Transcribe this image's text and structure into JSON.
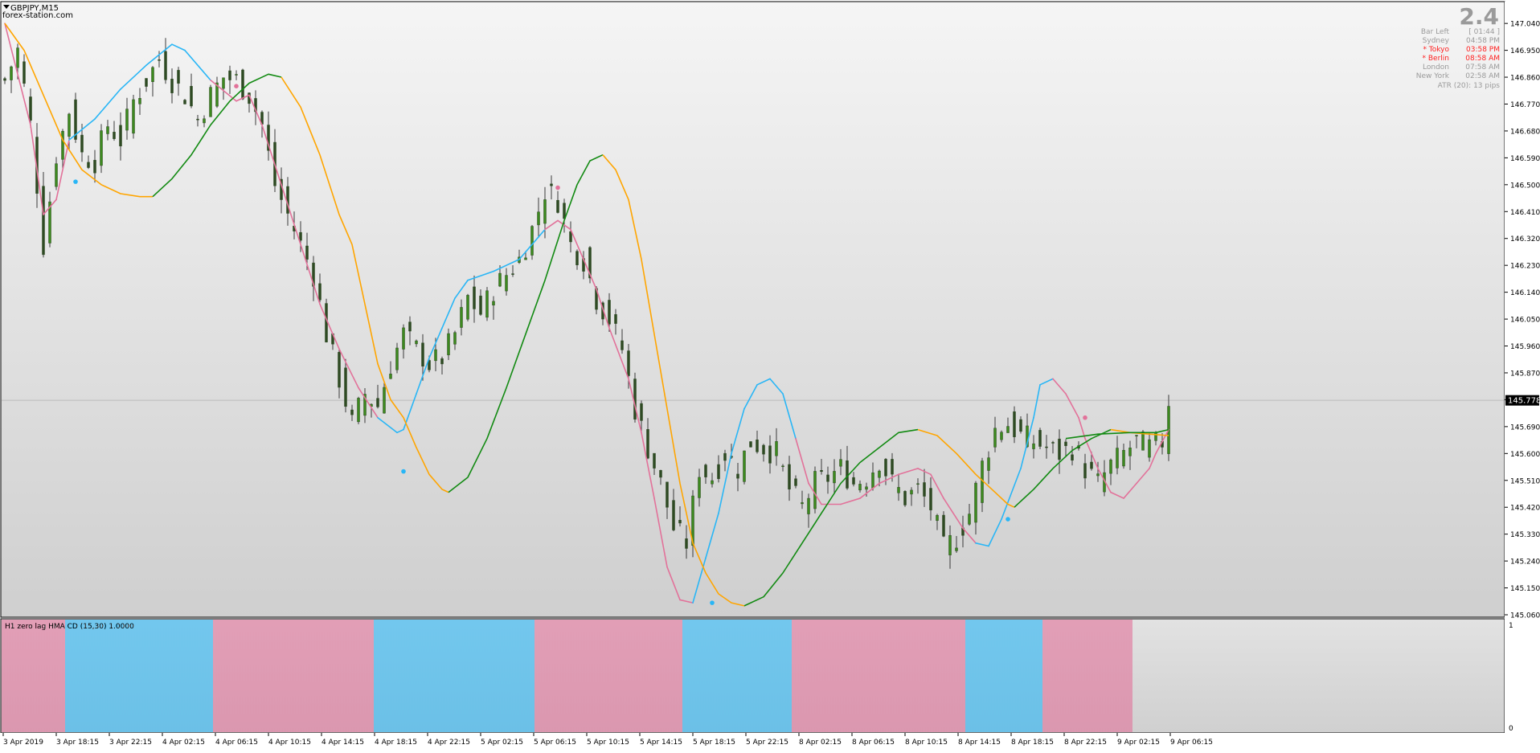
{
  "window": {
    "title": "GBPJPY,M15",
    "watermark": "forex-station.com"
  },
  "info_panel": {
    "big_value": "2.4",
    "rows": [
      {
        "label": "Bar Left",
        "value": "[ 01:44 ]",
        "color": "#9a9a9a"
      },
      {
        "label": "Sydney",
        "value": "04:58 PM",
        "color": "#9a9a9a"
      },
      {
        "label": "* Tokyo",
        "value": "03:58 PM",
        "color": "#ff2020"
      },
      {
        "label": "* Berlin",
        "value": "08:58 AM",
        "color": "#ff2020"
      },
      {
        "label": "London",
        "value": "07:58 AM",
        "color": "#9a9a9a"
      },
      {
        "label": "New York",
        "value": "02:58 AM",
        "color": "#9a9a9a"
      }
    ],
    "atr": "ATR (20): 13 pips"
  },
  "current_price": "145.778",
  "subwindow": {
    "label": "H1 zero lag HMA CD (15,30) 1.0000",
    "axis_top": "1",
    "axis_bottom": "0",
    "segments": [
      {
        "start": 0,
        "end": 10,
        "state": "down"
      },
      {
        "start": 10,
        "end": 33,
        "state": "up"
      },
      {
        "start": 33,
        "end": 58,
        "state": "down"
      },
      {
        "start": 58,
        "end": 83,
        "state": "up"
      },
      {
        "start": 83,
        "end": 106,
        "state": "down"
      },
      {
        "start": 106,
        "end": 123,
        "state": "up"
      },
      {
        "start": 123,
        "end": 150,
        "state": "down"
      },
      {
        "start": 150,
        "end": 162,
        "state": "up"
      },
      {
        "start": 162,
        "end": 176,
        "state": "down"
      }
    ]
  },
  "colors": {
    "bull_candle": "#3c8a1e",
    "bear_candle": "#3a3a3a",
    "hma_up": "#29b6f6",
    "hma_down": "#e2729a",
    "slow_orange": "#ffa500",
    "slow_green": "#128a12",
    "bg_top": "#f4f4f4",
    "bg_bottom": "#cfcfcf"
  },
  "chart_data": {
    "type": "candlestick",
    "symbol": "GBPJPY",
    "timeframe": "M15",
    "ylim": [
      145.06,
      147.07
    ],
    "y_ticks": [
      "147.040",
      "146.950",
      "146.860",
      "146.770",
      "146.680",
      "146.590",
      "146.500",
      "146.410",
      "146.320",
      "146.230",
      "146.140",
      "146.050",
      "145.960",
      "145.870",
      "145.780",
      "145.690",
      "145.600",
      "145.510",
      "145.420",
      "145.330",
      "145.240",
      "145.150",
      "145.060"
    ],
    "x_labels": [
      "3 Apr 2019",
      "3 Apr 18:15",
      "3 Apr 22:15",
      "4 Apr 02:15",
      "4 Apr 06:15",
      "4 Apr 10:15",
      "4 Apr 14:15",
      "4 Apr 18:15",
      "4 Apr 22:15",
      "5 Apr 02:15",
      "5 Apr 06:15",
      "5 Apr 10:15",
      "5 Apr 14:15",
      "5 Apr 18:15",
      "5 Apr 22:15",
      "8 Apr 02:15",
      "8 Apr 06:15",
      "8 Apr 10:15",
      "8 Apr 14:15",
      "8 Apr 18:15",
      "8 Apr 22:15",
      "9 Apr 02:15",
      "9 Apr 06:15"
    ],
    "close_path": [
      [
        0,
        146.85
      ],
      [
        2,
        146.95
      ],
      [
        4,
        146.7
      ],
      [
        6,
        146.3
      ],
      [
        8,
        146.6
      ],
      [
        10,
        146.75
      ],
      [
        12,
        146.6
      ],
      [
        14,
        146.58
      ],
      [
        16,
        146.7
      ],
      [
        18,
        146.65
      ],
      [
        20,
        146.78
      ],
      [
        22,
        146.85
      ],
      [
        24,
        146.92
      ],
      [
        26,
        146.85
      ],
      [
        28,
        146.8
      ],
      [
        30,
        146.72
      ],
      [
        32,
        146.8
      ],
      [
        34,
        146.86
      ],
      [
        36,
        146.85
      ],
      [
        38,
        146.8
      ],
      [
        40,
        146.7
      ],
      [
        42,
        146.5
      ],
      [
        44,
        146.4
      ],
      [
        46,
        146.3
      ],
      [
        48,
        146.2
      ],
      [
        50,
        146.0
      ],
      [
        52,
        145.85
      ],
      [
        54,
        145.7
      ],
      [
        56,
        145.8
      ],
      [
        58,
        145.76
      ],
      [
        60,
        145.9
      ],
      [
        62,
        146.0
      ],
      [
        64,
        145.95
      ],
      [
        66,
        145.9
      ],
      [
        68,
        145.92
      ],
      [
        70,
        146.0
      ],
      [
        72,
        146.12
      ],
      [
        74,
        146.07
      ],
      [
        76,
        146.15
      ],
      [
        78,
        146.2
      ],
      [
        80,
        146.25
      ],
      [
        82,
        146.35
      ],
      [
        84,
        146.48
      ],
      [
        86,
        146.45
      ],
      [
        88,
        146.3
      ],
      [
        90,
        146.25
      ],
      [
        92,
        146.12
      ],
      [
        94,
        146.05
      ],
      [
        96,
        145.95
      ],
      [
        98,
        145.75
      ],
      [
        100,
        145.62
      ],
      [
        102,
        145.5
      ],
      [
        104,
        145.35
      ],
      [
        106,
        145.3
      ],
      [
        108,
        145.55
      ],
      [
        110,
        145.52
      ],
      [
        112,
        145.6
      ],
      [
        114,
        145.55
      ],
      [
        116,
        145.64
      ],
      [
        118,
        145.62
      ],
      [
        120,
        145.6
      ],
      [
        122,
        145.48
      ],
      [
        124,
        145.42
      ],
      [
        126,
        145.5
      ],
      [
        128,
        145.52
      ],
      [
        130,
        145.55
      ],
      [
        132,
        145.5
      ],
      [
        134,
        145.52
      ],
      [
        136,
        145.58
      ],
      [
        138,
        145.5
      ],
      [
        140,
        145.45
      ],
      [
        142,
        145.48
      ],
      [
        144,
        145.42
      ],
      [
        146,
        145.28
      ],
      [
        148,
        145.32
      ],
      [
        150,
        145.4
      ],
      [
        152,
        145.56
      ],
      [
        154,
        145.68
      ],
      [
        156,
        145.7
      ],
      [
        158,
        145.66
      ],
      [
        160,
        145.64
      ],
      [
        162,
        145.62
      ],
      [
        164,
        145.6
      ],
      [
        166,
        145.62
      ],
      [
        168,
        145.55
      ],
      [
        170,
        145.5
      ],
      [
        172,
        145.56
      ],
      [
        174,
        145.6
      ],
      [
        176,
        145.64
      ],
      [
        178,
        145.62
      ],
      [
        180,
        145.64
      ],
      [
        181,
        145.778
      ]
    ],
    "series": [
      {
        "name": "HMA fast",
        "points": [
          [
            0,
            147.04
          ],
          [
            4,
            146.7
          ],
          [
            6,
            146.4
          ],
          [
            8,
            146.45
          ],
          [
            10,
            146.65
          ],
          [
            14,
            146.72
          ],
          [
            18,
            146.82
          ],
          [
            22,
            146.9
          ],
          [
            26,
            146.97
          ],
          [
            28,
            146.95
          ],
          [
            32,
            146.85
          ],
          [
            36,
            146.78
          ],
          [
            38,
            146.8
          ],
          [
            40,
            146.7
          ],
          [
            43,
            146.5
          ],
          [
            46,
            146.3
          ],
          [
            49,
            146.1
          ],
          [
            52,
            145.95
          ],
          [
            55,
            145.82
          ],
          [
            58,
            145.72
          ],
          [
            61,
            145.67
          ],
          [
            62,
            145.68
          ],
          [
            64,
            145.8
          ],
          [
            66,
            145.92
          ],
          [
            68,
            146.02
          ],
          [
            70,
            146.12
          ],
          [
            72,
            146.18
          ],
          [
            76,
            146.21
          ],
          [
            80,
            146.25
          ],
          [
            84,
            146.35
          ],
          [
            86,
            146.38
          ],
          [
            88,
            146.35
          ],
          [
            90,
            146.25
          ],
          [
            92,
            146.15
          ],
          [
            94,
            146.02
          ],
          [
            97,
            145.85
          ],
          [
            99,
            145.67
          ],
          [
            101,
            145.45
          ],
          [
            103,
            145.22
          ],
          [
            105,
            145.11
          ],
          [
            107,
            145.1
          ],
          [
            109,
            145.25
          ],
          [
            111,
            145.4
          ],
          [
            113,
            145.6
          ],
          [
            115,
            145.75
          ],
          [
            117,
            145.83
          ],
          [
            119,
            145.85
          ],
          [
            121,
            145.8
          ],
          [
            123,
            145.65
          ],
          [
            125,
            145.5
          ],
          [
            127,
            145.43
          ],
          [
            130,
            145.43
          ],
          [
            133,
            145.45
          ],
          [
            136,
            145.5
          ],
          [
            139,
            145.53
          ],
          [
            142,
            145.55
          ],
          [
            144,
            145.53
          ],
          [
            146,
            145.45
          ],
          [
            149,
            145.35
          ],
          [
            151,
            145.3
          ],
          [
            153,
            145.29
          ],
          [
            155,
            145.38
          ],
          [
            158,
            145.55
          ],
          [
            160,
            145.72
          ],
          [
            161,
            145.83
          ],
          [
            163,
            145.85
          ],
          [
            165,
            145.8
          ],
          [
            167,
            145.72
          ],
          [
            168,
            145.65
          ],
          [
            170,
            145.55
          ],
          [
            172,
            145.47
          ],
          [
            174,
            145.45
          ],
          [
            176,
            145.5
          ],
          [
            178,
            145.55
          ],
          [
            179,
            145.6
          ],
          [
            181,
            145.68
          ]
        ]
      },
      {
        "name": "Slow A",
        "points": [
          [
            0,
            147.04
          ],
          [
            3,
            146.95
          ],
          [
            6,
            146.8
          ],
          [
            9,
            146.65
          ],
          [
            12,
            146.55
          ],
          [
            15,
            146.5
          ],
          [
            18,
            146.47
          ],
          [
            21,
            146.46
          ],
          [
            23,
            146.46
          ]
        ],
        "color_key": "slow_orange"
      },
      {
        "name": "Slow B",
        "points": [
          [
            23,
            146.46
          ],
          [
            26,
            146.52
          ],
          [
            29,
            146.6
          ],
          [
            32,
            146.7
          ],
          [
            35,
            146.78
          ],
          [
            38,
            146.84
          ],
          [
            41,
            146.87
          ],
          [
            43,
            146.86
          ]
        ],
        "color_key": "slow_green"
      },
      {
        "name": "Slow C",
        "points": [
          [
            43,
            146.86
          ],
          [
            46,
            146.76
          ],
          [
            49,
            146.6
          ],
          [
            52,
            146.4
          ],
          [
            54,
            146.3
          ],
          [
            56,
            146.1
          ],
          [
            58,
            145.9
          ],
          [
            60,
            145.78
          ],
          [
            62,
            145.72
          ],
          [
            64,
            145.62
          ],
          [
            66,
            145.53
          ],
          [
            68,
            145.48
          ],
          [
            69,
            145.47
          ]
        ],
        "color_key": "slow_orange"
      },
      {
        "name": "Slow D",
        "points": [
          [
            69,
            145.47
          ],
          [
            72,
            145.52
          ],
          [
            75,
            145.65
          ],
          [
            78,
            145.82
          ],
          [
            81,
            146.0
          ],
          [
            84,
            146.18
          ],
          [
            87,
            146.38
          ],
          [
            89,
            146.5
          ],
          [
            91,
            146.58
          ],
          [
            93,
            146.6
          ]
        ],
        "color_key": "slow_green"
      },
      {
        "name": "Slow E",
        "points": [
          [
            93,
            146.6
          ],
          [
            95,
            146.55
          ],
          [
            97,
            146.45
          ],
          [
            99,
            146.25
          ],
          [
            101,
            146.0
          ],
          [
            103,
            145.75
          ],
          [
            105,
            145.5
          ],
          [
            107,
            145.3
          ],
          [
            109,
            145.2
          ],
          [
            111,
            145.13
          ],
          [
            113,
            145.1
          ],
          [
            115,
            145.09
          ]
        ],
        "color_key": "slow_orange"
      },
      {
        "name": "Slow F",
        "points": [
          [
            115,
            145.09
          ],
          [
            118,
            145.12
          ],
          [
            121,
            145.2
          ],
          [
            124,
            145.3
          ],
          [
            127,
            145.4
          ],
          [
            130,
            145.5
          ],
          [
            133,
            145.57
          ],
          [
            136,
            145.62
          ],
          [
            139,
            145.67
          ],
          [
            142,
            145.68
          ]
        ],
        "color_key": "slow_green"
      },
      {
        "name": "Slow G",
        "points": [
          [
            142,
            145.68
          ],
          [
            145,
            145.66
          ],
          [
            148,
            145.6
          ],
          [
            151,
            145.53
          ],
          [
            154,
            145.47
          ],
          [
            156,
            145.43
          ],
          [
            157,
            145.42
          ]
        ],
        "color_key": "slow_orange"
      },
      {
        "name": "Slow H",
        "points": [
          [
            157,
            145.42
          ],
          [
            160,
            145.48
          ],
          [
            163,
            145.55
          ],
          [
            166,
            145.61
          ],
          [
            169,
            145.65
          ],
          [
            171,
            145.67
          ],
          [
            172,
            145.68
          ]
        ],
        "color_key": "slow_green"
      },
      {
        "name": "Slow I",
        "points": [
          [
            172,
            145.68
          ],
          [
            175,
            145.67
          ],
          [
            178,
            145.665
          ],
          [
            181,
            145.66
          ]
        ],
        "color_key": "slow_orange"
      },
      {
        "name": "Slow J",
        "points": [
          [
            165,
            145.65
          ],
          [
            170,
            145.665
          ],
          [
            175,
            145.67
          ],
          [
            179,
            145.67
          ],
          [
            181,
            145.68
          ]
        ],
        "color_key": "slow_green"
      }
    ],
    "dots": [
      {
        "x": 11,
        "y": 146.51,
        "color_key": "hma_up"
      },
      {
        "x": 36,
        "y": 146.83,
        "color_key": "hma_down"
      },
      {
        "x": 62,
        "y": 145.54,
        "color_key": "hma_up"
      },
      {
        "x": 110,
        "y": 145.1,
        "color_key": "hma_up"
      },
      {
        "x": 156,
        "y": 145.38,
        "color_key": "hma_up"
      },
      {
        "x": 168,
        "y": 145.72,
        "color_key": "hma_down"
      },
      {
        "x": 86,
        "y": 146.49,
        "color_key": "hma_down"
      }
    ]
  }
}
